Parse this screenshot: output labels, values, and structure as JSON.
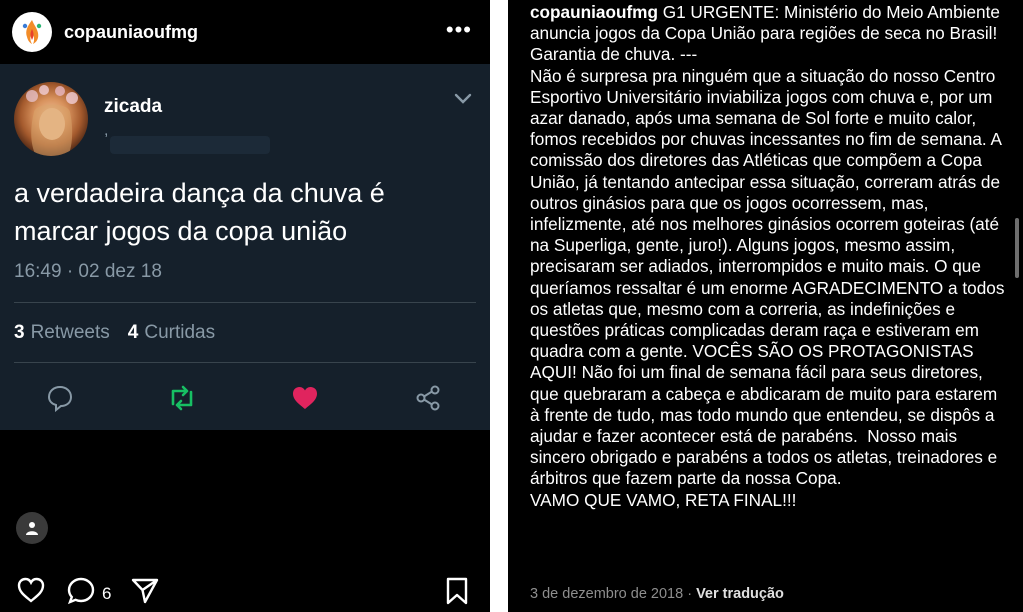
{
  "instagram_post": {
    "account": "copauniaoufmg",
    "more_label": "•••",
    "comment_count": "6"
  },
  "tweet": {
    "name": "zicada",
    "handle_prefix": ",",
    "text": "a verdadeira dança da chuva é marcar jogos da copa união",
    "time": "16:49 · 02 dez 18",
    "retweets_count": "3",
    "retweets_label": "Retweets",
    "likes_count": "4",
    "likes_label": "Curtidas"
  },
  "caption": {
    "username": "copauniaoufmg",
    "text": " G1 URGENTE: Ministério do Meio Ambiente anuncia jogos da Copa União para regiões de seca no Brasil! Garantia de chuva. ---\nNão é surpresa pra ninguém que a situação do nosso Centro Esportivo Universitário inviabiliza jogos com chuva e, por um azar danado, após uma semana de Sol forte e muito calor, fomos recebidos por chuvas incessantes no fim de semana. A comissão dos diretores das Atléticas que compõem a Copa União, já tentando antecipar essa situação, correram atrás de outros ginásios para que os jogos ocorressem, mas, infelizmente, até nos melhores ginásios ocorrem goteiras (até na Superliga, gente, juro!). Alguns jogos, mesmo assim, precisaram ser adiados, interrompidos e muito mais. O que queríamos ressaltar é um enorme AGRADECIMENTO a todos os atletas que, mesmo com a correria, as indefinições e questões práticas complicadas deram raça e estiveram em quadra com a gente. VOCÊS SÃO OS PROTAGONISTAS AQUI! Não foi um final de semana fácil para seus diretores, que quebraram a cabeça e abdicaram de muito para estarem à frente de tudo, mas todo mundo que entendeu, se dispôs a ajudar e fazer acontecer está de parabéns.  Nosso mais sincero obrigado e parabéns a todos os atletas, treinadores e árbitros que fazem parte da nossa Copa.\nVAMO QUE VAMO, RETA FINAL!!!",
    "date": "3 de dezembro de 2018",
    "separator": " · ",
    "translate_label": "Ver tradução"
  },
  "colors": {
    "tweet_bg": "#15202b",
    "retweet_green": "#17bf63",
    "like_pink": "#e0245e",
    "muted": "#8899a6"
  },
  "icons": [
    "chevron-down-icon",
    "reply-icon",
    "retweet-icon",
    "heart-filled-icon",
    "share-icon",
    "user-icon",
    "heart-outline-icon",
    "comment-icon",
    "send-icon",
    "bookmark-icon",
    "more-icon"
  ]
}
